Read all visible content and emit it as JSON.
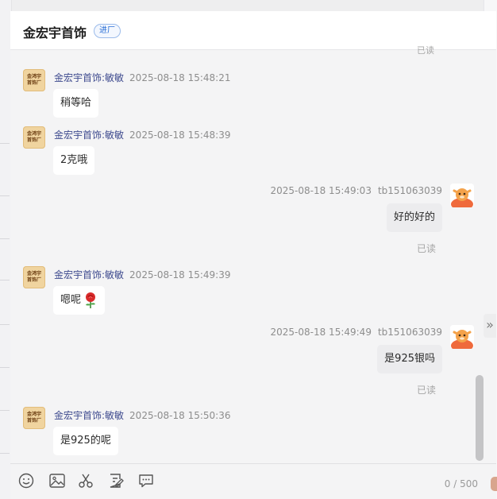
{
  "header": {
    "shop_name": "金宏宇首饰",
    "badge": "进厂"
  },
  "peek_read": "已读",
  "shop_avatar_text": "金鸿宇首饰厂",
  "messages": [
    {
      "direction": "in",
      "sender": "金宏宇首饰:敏敏",
      "time": "2025-08-18 15:48:21",
      "text": "稍等哈"
    },
    {
      "direction": "in",
      "sender": "金宏宇首饰:敏敏",
      "time": "2025-08-18 15:48:39",
      "text": "2克哦"
    },
    {
      "direction": "out",
      "sender": "tb151063039",
      "time": "2025-08-18 15:49:03",
      "text": "好的好的",
      "status": "已读"
    },
    {
      "direction": "in",
      "sender": "金宏宇首饰:敏敏",
      "time": "2025-08-18 15:49:39",
      "text": "嗯呢",
      "emoji": "rose-icon"
    },
    {
      "direction": "out",
      "sender": "tb151063039",
      "time": "2025-08-18 15:49:49",
      "text": "是925银吗",
      "status": "已读"
    },
    {
      "direction": "in",
      "sender": "金宏宇首饰:敏敏",
      "time": "2025-08-18 15:50:36",
      "text": "是925的呢"
    }
  ],
  "toolbar": {
    "icons": [
      "emoji-icon",
      "image-icon",
      "scissors-icon",
      "edit-note-icon",
      "chat-bubble-icon"
    ],
    "counter": "0 / 500"
  },
  "colors": {
    "sender_name": "#3f4b8f",
    "badge_blue": "#2a6fd6"
  }
}
